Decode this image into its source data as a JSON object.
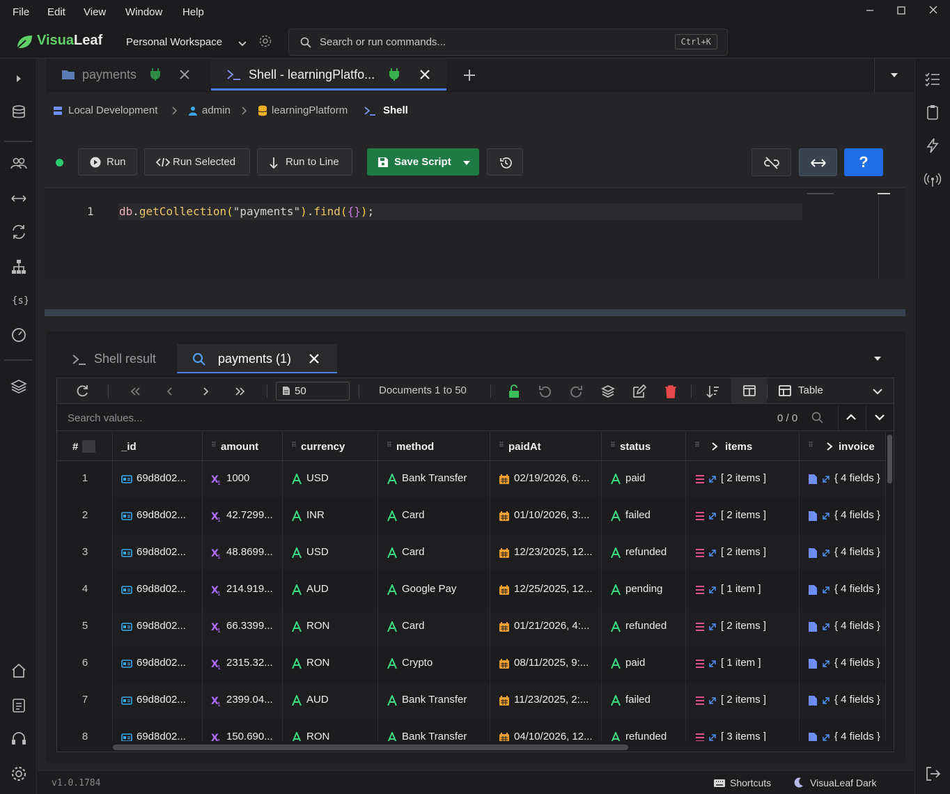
{
  "menu": [
    "File",
    "Edit",
    "View",
    "Window",
    "Help"
  ],
  "app": {
    "logo_part1": "Visua",
    "logo_part2": "Leaf",
    "workspace": "Personal Workspace"
  },
  "search": {
    "placeholder": "Search or run commands...",
    "shortcut": "Ctrl+K"
  },
  "tabs": [
    {
      "label": "payments",
      "icon": "folder-icon",
      "connected": true
    },
    {
      "label": "Shell - learningPlatfo...",
      "icon": "terminal-icon",
      "connected": true,
      "active": true
    }
  ],
  "breadcrumb": {
    "connection": "Local Development",
    "user": "admin",
    "database": "learningPlatform",
    "current": "Shell"
  },
  "toolbar": {
    "run": "Run",
    "run_selected": "Run Selected",
    "run_to_line": "Run to Line",
    "save_script": "Save Script",
    "help": "?"
  },
  "editor": {
    "line_number": "1",
    "tokens": {
      "db": "db",
      "dot1": ".",
      "method1": "getCollection",
      "p1": "(",
      "str": "\"payments\"",
      "p2": ")",
      "dot2": ".",
      "method2": "find",
      "p3": "(",
      "obj": "{}",
      "p4": ")",
      "semi": ";"
    }
  },
  "results": {
    "tab_shell": "Shell result",
    "tab_collection": "payments (1)",
    "page_size": "50",
    "range": "Documents 1 to 50",
    "view_mode": "Table",
    "search_placeholder": "Search values...",
    "match_count": "0 / 0"
  },
  "table": {
    "columns": [
      "#",
      "_id",
      "amount",
      "currency",
      "method",
      "paidAt",
      "status",
      "items",
      "invoice"
    ],
    "rows": [
      {
        "n": "1",
        "id": "69d8d02...",
        "amount": "1000",
        "currency": "USD",
        "method": "Bank Transfer",
        "paidAt": "02/19/2026, 6:...",
        "status": "paid",
        "items": "[ 2 items ]",
        "invoice": "{ 4 fields }"
      },
      {
        "n": "2",
        "id": "69d8d02...",
        "amount": "42.7299...",
        "currency": "INR",
        "method": "Card",
        "paidAt": "01/10/2026, 3:...",
        "status": "failed",
        "items": "[ 2 items ]",
        "invoice": "{ 4 fields }"
      },
      {
        "n": "3",
        "id": "69d8d02...",
        "amount": "48.8699...",
        "currency": "USD",
        "method": "Card",
        "paidAt": "12/23/2025, 12...",
        "status": "refunded",
        "items": "[ 2 items ]",
        "invoice": "{ 4 fields }"
      },
      {
        "n": "4",
        "id": "69d8d02...",
        "amount": "214.919...",
        "currency": "AUD",
        "method": "Google Pay",
        "paidAt": "12/25/2025, 12...",
        "status": "pending",
        "items": "[ 1 item ]",
        "invoice": "{ 4 fields }"
      },
      {
        "n": "5",
        "id": "69d8d02...",
        "amount": "66.3399...",
        "currency": "RON",
        "method": "Card",
        "paidAt": "01/21/2026, 4:...",
        "status": "refunded",
        "items": "[ 2 items ]",
        "invoice": "{ 4 fields }"
      },
      {
        "n": "6",
        "id": "69d8d02...",
        "amount": "2315.32...",
        "currency": "RON",
        "method": "Crypto",
        "paidAt": "08/11/2025, 9:...",
        "status": "paid",
        "items": "[ 1 item ]",
        "invoice": "{ 4 fields }"
      },
      {
        "n": "7",
        "id": "69d8d02...",
        "amount": "2399.04...",
        "currency": "AUD",
        "method": "Bank Transfer",
        "paidAt": "11/23/2025, 2:...",
        "status": "failed",
        "items": "[ 2 items ]",
        "invoice": "{ 4 fields }"
      },
      {
        "n": "8",
        "id": "69d8d02...",
        "amount": "150.690...",
        "currency": "RON",
        "method": "Bank Transfer",
        "paidAt": "04/10/2026, 12...",
        "status": "refunded",
        "items": "[ 3 items ]",
        "invoice": "{ 4 fields }"
      }
    ]
  },
  "statusbar": {
    "version": "v1.0.1784",
    "shortcuts": "Shortcuts",
    "theme": "VisuaLeaf Dark"
  },
  "colors": {
    "accent": "#4f7be3",
    "brand_green": "#5fd068",
    "save_green": "#1f7a45",
    "help_blue": "#1f6ee8",
    "status_dot": "#2ecc71",
    "string_icon": "#3ddc84",
    "number_icon": "#b06cff",
    "date_icon": "#f0a030",
    "array_icon": "#e0508a",
    "object_icon": "#6f8dff",
    "objectid_icon": "#3aa8e8",
    "delete_red": "#e5484d"
  }
}
